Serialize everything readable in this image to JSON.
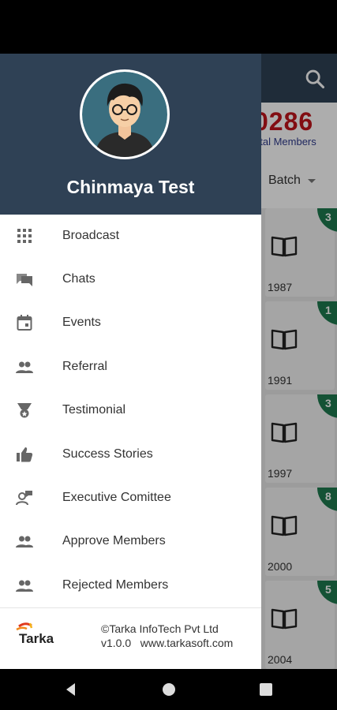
{
  "background": {
    "total_count": "0286",
    "total_label": "otal Members",
    "filter_label": "Batch",
    "rows": [
      {
        "badge": "3",
        "year": "1987"
      },
      {
        "badge": "1",
        "year": "1991"
      },
      {
        "badge": "3",
        "year": "1997"
      },
      {
        "badge": "8",
        "year": "2000"
      },
      {
        "badge": "5",
        "year": "2004"
      }
    ]
  },
  "drawer": {
    "user_name": "Chinmaya Test",
    "menu": [
      {
        "label": "Broadcast",
        "icon": "grid-icon"
      },
      {
        "label": "Chats",
        "icon": "chat-icon"
      },
      {
        "label": "Events",
        "icon": "calendar-icon"
      },
      {
        "label": "Referral",
        "icon": "people-icon"
      },
      {
        "label": "Testimonial",
        "icon": "award-icon"
      },
      {
        "label": "Success Stories",
        "icon": "thumbs-up-icon"
      },
      {
        "label": "Executive Comittee",
        "icon": "group-chat-icon"
      },
      {
        "label": "Approve Members",
        "icon": "people-icon"
      },
      {
        "label": "Rejected Members",
        "icon": "people-icon"
      }
    ],
    "footer": {
      "logo_text": "Tarka",
      "copyright": "©Tarka InfoTech Pvt Ltd",
      "version_site": "v1.0.0   www.tarkasoft.com"
    }
  },
  "colors": {
    "header_bg": "#2f4155",
    "count_red": "#c0141b",
    "badge_green": "#1e7a4e"
  }
}
